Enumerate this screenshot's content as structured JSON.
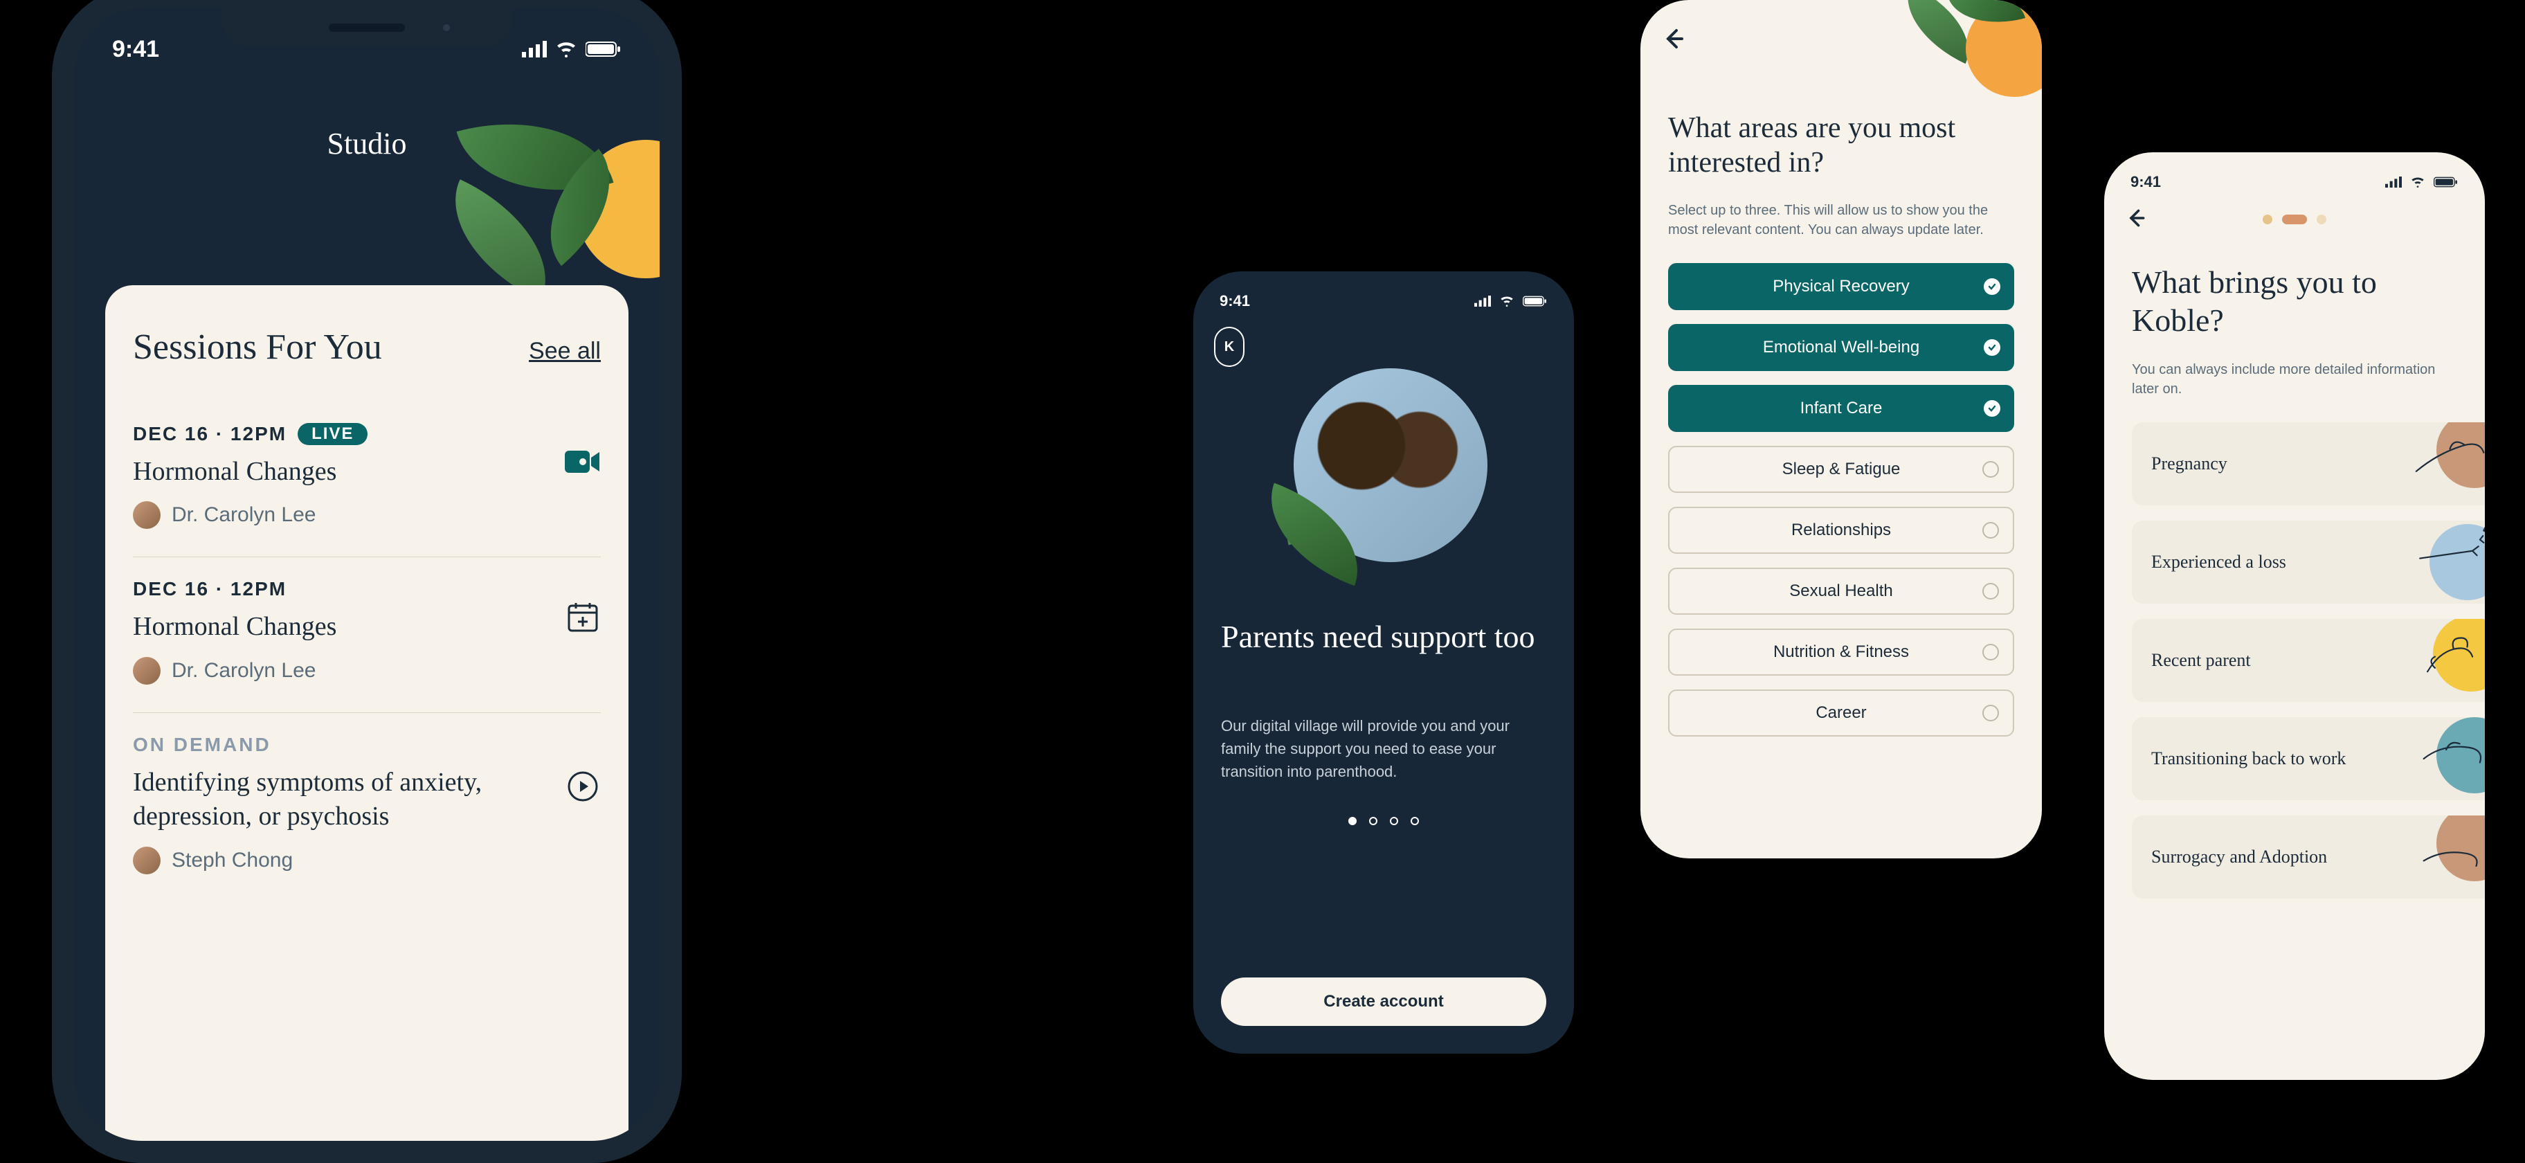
{
  "status_time": "9:41",
  "phone1": {
    "title": "Studio",
    "card_title": "Sessions For You",
    "see_all": "See all",
    "sessions": [
      {
        "date": "DEC 16 · 12PM",
        "live": "LIVE",
        "title": "Hormonal Changes",
        "author": "Dr. Carolyn Lee",
        "icon": "video"
      },
      {
        "date": "DEC 16 · 12PM",
        "title": "Hormonal Changes",
        "author": "Dr. Carolyn Lee",
        "icon": "calendar-add"
      },
      {
        "on_demand": "ON DEMAND",
        "title": "Identifying symptoms of anxiety, depression, or psychosis",
        "author": "Steph Chong",
        "icon": "play"
      }
    ]
  },
  "phone2": {
    "logo_letter": "K",
    "title": "Parents need support too",
    "body": "Our digital village will provide you and your family the support you need to ease your transition into parenthood.",
    "cta": "Create account"
  },
  "phone3": {
    "title": "What areas are you most interested in?",
    "sub": "Select up to three. This will allow us to show you the most relevant content. You can always update later.",
    "options": [
      {
        "label": "Physical Recovery",
        "selected": true
      },
      {
        "label": "Emotional Well-being",
        "selected": true
      },
      {
        "label": "Infant Care",
        "selected": true
      },
      {
        "label": "Sleep & Fatigue",
        "selected": false
      },
      {
        "label": "Relationships",
        "selected": false
      },
      {
        "label": "Sexual Health",
        "selected": false
      },
      {
        "label": "Nutrition & Fitness",
        "selected": false
      },
      {
        "label": "Career",
        "selected": false
      }
    ]
  },
  "phone4": {
    "title": "What brings you to Koble?",
    "sub": "You can always include more detailed information later on.",
    "options": [
      "Pregnancy",
      "Experienced a loss",
      "Recent parent",
      "Transitioning back to work",
      "Surrogacy and Adoption"
    ]
  }
}
